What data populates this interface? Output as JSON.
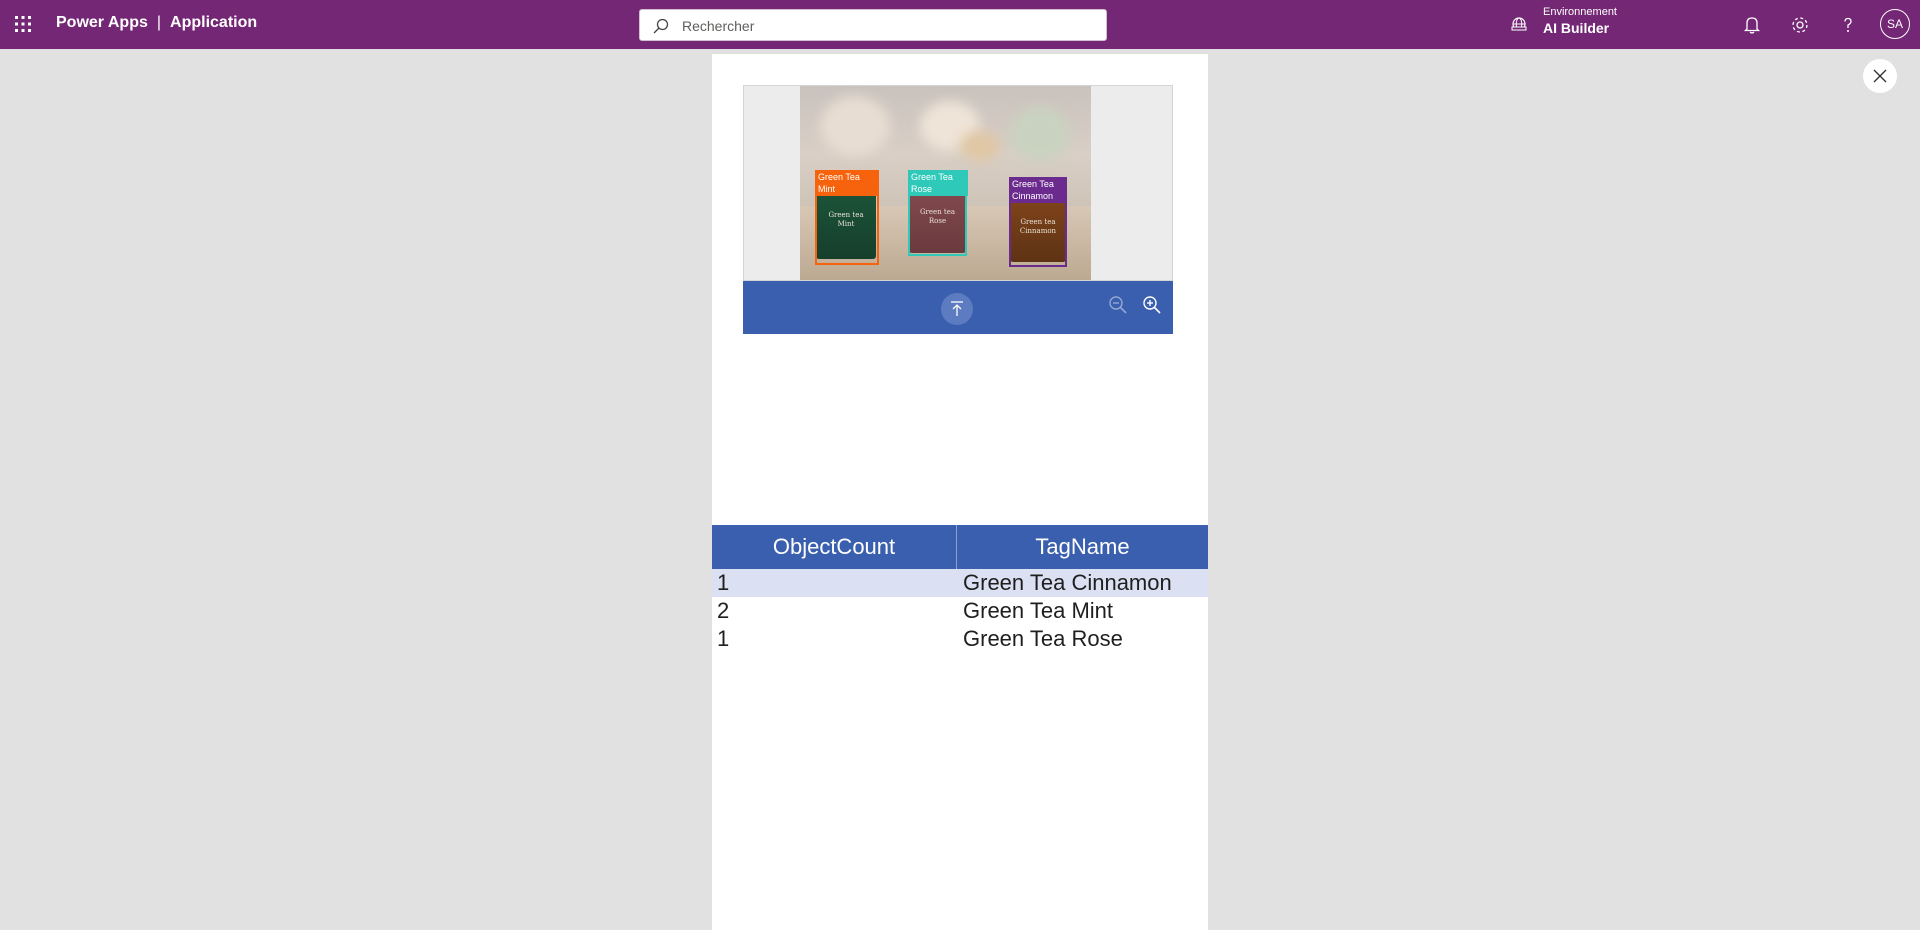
{
  "header": {
    "app_name": "Power Apps",
    "separator": "|",
    "section": "Application",
    "search_placeholder": "Rechercher",
    "environment_label": "Environnement",
    "environment_value": "AI Builder",
    "avatar_initials": "SA",
    "icons": [
      "app-launcher-icon",
      "search-icon",
      "environment-icon",
      "bell-icon",
      "gear-icon",
      "help-icon"
    ]
  },
  "image": {
    "detections": [
      {
        "label": "Green Tea Mint",
        "line1": "Green Tea",
        "line2": "Mint",
        "color": "#f7630c",
        "pack_text1": "Green tea",
        "pack_text2": "Mint"
      },
      {
        "label": "Green Tea Rose",
        "line1": "Green Tea",
        "line2": "Rose",
        "color": "#2ec9b8",
        "pack_text1": "Green tea",
        "pack_text2": "Rose"
      },
      {
        "label": "Green Tea Cinnamon",
        "line1": "Green Tea",
        "line2": "Cinnamon",
        "color": "#6b2b8e",
        "pack_text1": "Green tea",
        "pack_text2": "Cinnamon"
      }
    ]
  },
  "toolbar": {
    "icons": [
      "upload-icon",
      "zoom-out-icon",
      "zoom-in-icon"
    ],
    "color": "#3b5faf"
  },
  "results_table": {
    "headers": [
      "ObjectCount",
      "TagName"
    ],
    "rows": [
      {
        "count": "1",
        "tag": "Green Tea Cinnamon",
        "selected": true
      },
      {
        "count": "2",
        "tag": "Green Tea Mint",
        "selected": false
      },
      {
        "count": "1",
        "tag": "Green Tea Rose",
        "selected": false
      }
    ]
  },
  "colors": {
    "brand": "#742774",
    "accent": "#3b5faf",
    "selected_row": "#dbe1f2"
  }
}
